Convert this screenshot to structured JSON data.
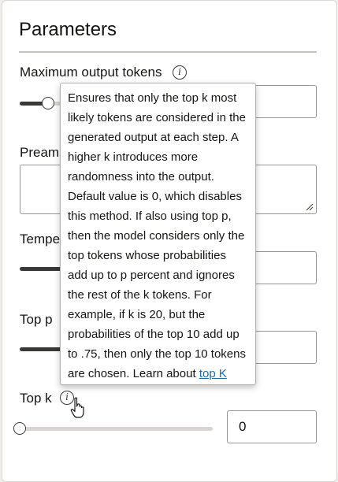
{
  "panel": {
    "title": "Parameters"
  },
  "params": {
    "max_tokens": {
      "label": "Maximum output tokens",
      "value": "0"
    },
    "preamble": {
      "label": "Preamb"
    },
    "temperature": {
      "label": "Tempe"
    },
    "top_p": {
      "label": "Top p"
    },
    "top_k": {
      "label": "Top k",
      "value": "0"
    }
  },
  "tooltip": {
    "text": "Ensures that only the top k most likely tokens are considered in the generated output at each step. A higher k introduces more randomness into the output. Default value is 0, which disables this method. If also using top p, then the model considers only the top tokens whose probabilities add up to p percent and ignores the rest of the k tokens. For example, if k is 20, but the probabilities of the top 10 add up to .75, then only the top 10 tokens are chosen.",
    "learn_prefix": "Learn about",
    "learn_link": "top K"
  },
  "icons": {
    "info": "info-icon",
    "cursor": "hand-pointer-cursor-icon",
    "resize": "resize-grip-icon"
  },
  "colors": {
    "accent_link": "#1f6aa6",
    "slider_fill": "#3a3835",
    "slider_track": "#d8d4cf"
  }
}
